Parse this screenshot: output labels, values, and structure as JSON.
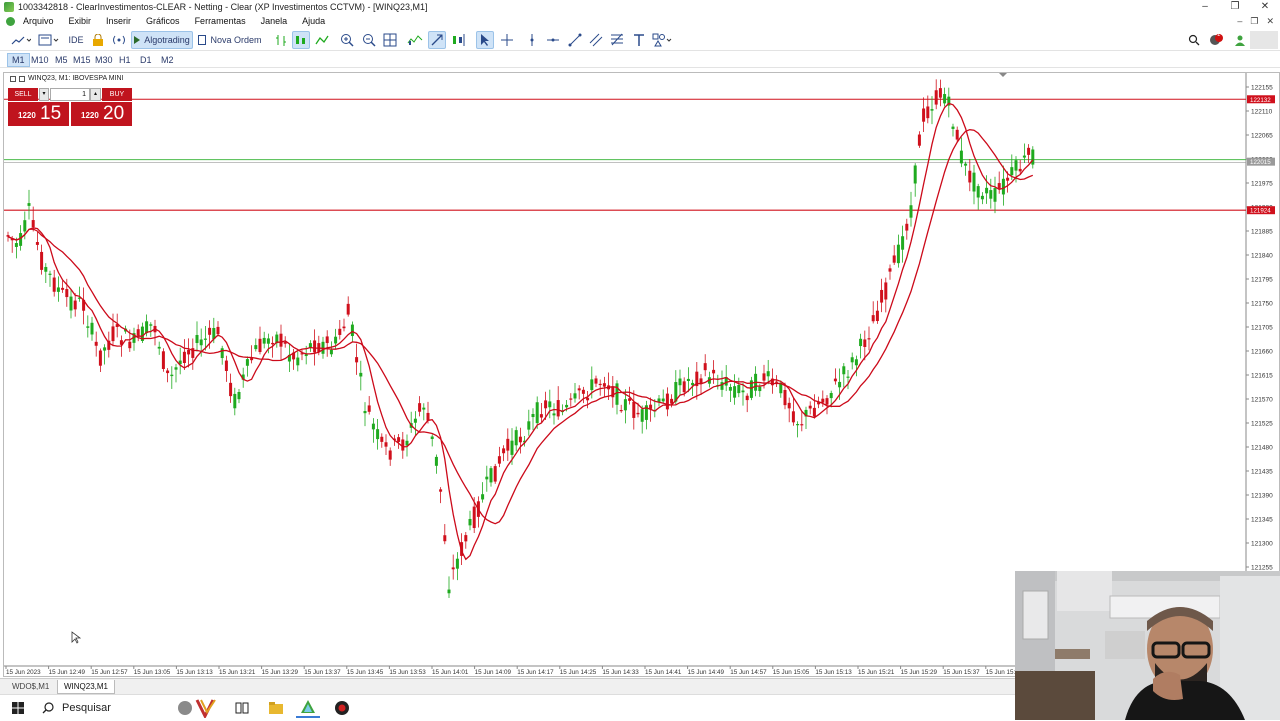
{
  "window": {
    "title": "1003342818 - ClearInvestimentos-CLEAR - Netting - Clear (XP Investimentos CCTVM) - [WINQ23,M1]",
    "controls": [
      "–",
      "❐",
      "✕"
    ]
  },
  "menu": {
    "items": [
      "Arquivo",
      "Exibir",
      "Inserir",
      "Gráficos",
      "Ferramentas",
      "Janela",
      "Ajuda"
    ],
    "mdi": [
      "–",
      "❐",
      "✕"
    ]
  },
  "toolbar": {
    "ide_label": "IDE",
    "algotrading_label": "Algotrading",
    "nova_ordem_label": "Nova Ordem",
    "notification_count": "1"
  },
  "timeframes": [
    "M1",
    "M10",
    "M5",
    "M15",
    "M30",
    "H1",
    "D1",
    "M2"
  ],
  "active_timeframe": "M1",
  "chart": {
    "title": "WINQ23, M1:  IBOVESPA MINI",
    "symbol": "WINQ23",
    "trade": {
      "sell_label": "SELL",
      "buy_label": "BUY",
      "qty": "1",
      "sell_price_small": "1220",
      "sell_price_big": "15",
      "buy_price_small": "1220",
      "buy_price_big": "20"
    },
    "price_levels": [
      "122155",
      "122110",
      "122065",
      "122020",
      "121975",
      "121930",
      "121885",
      "121840",
      "121795",
      "121750",
      "121705",
      "121660",
      "121615",
      "121570",
      "121525",
      "121480",
      "121435",
      "121390",
      "121345",
      "121300",
      "121255"
    ],
    "price_tags": {
      "top_line": "122132",
      "current": "122015",
      "low_line": "121924"
    },
    "time_labels": [
      "15 Jun 2023",
      "15 Jun 12:49",
      "15 Jun 12:57",
      "15 Jun 13:05",
      "15 Jun 13:13",
      "15 Jun 13:21",
      "15 Jun 13:29",
      "15 Jun 13:37",
      "15 Jun 13:45",
      "15 Jun 13:53",
      "15 Jun 14:01",
      "15 Jun 14:09",
      "15 Jun 14:17",
      "15 Jun 14:25",
      "15 Jun 14:33",
      "15 Jun 14:41",
      "15 Jun 14:49",
      "15 Jun 14:57",
      "15 Jun 15:05",
      "15 Jun 15:13",
      "15 Jun 15:21",
      "15 Jun 15:29",
      "15 Jun 15:37",
      "15 Jun 15:"
    ],
    "colors": {
      "bull": "#1faa1f",
      "bear": "#d0101c",
      "ma": "#cc0a1a",
      "current_line": "#4cbb4c"
    }
  },
  "chart_tabs": [
    "WDO$,M1",
    "WINQ23,M1"
  ],
  "active_chart_tab": "WINQ23,M1",
  "taskbar": {
    "search_placeholder": "Pesquisar"
  }
}
